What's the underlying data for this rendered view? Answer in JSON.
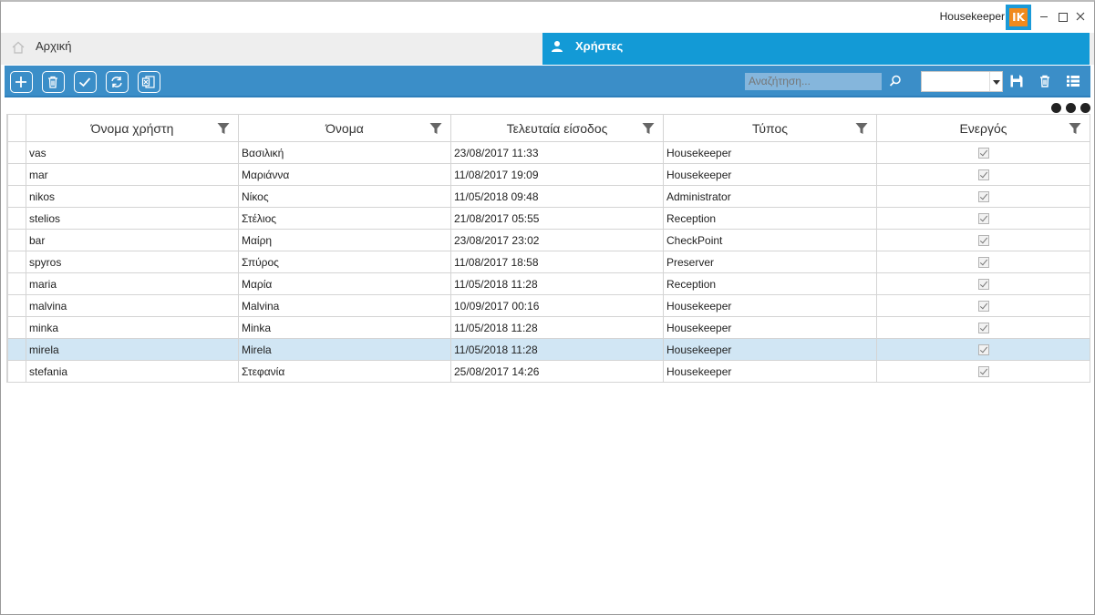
{
  "window": {
    "app_name": "Housekeeper",
    "logo_text": "IK"
  },
  "tabs": [
    {
      "label": "Αρχική",
      "icon": "home-icon"
    },
    {
      "label": "Χρήστες",
      "icon": "user-icon",
      "active": true
    }
  ],
  "toolbar": {
    "buttons": [
      "add-icon",
      "trash-icon",
      "check-icon",
      "refresh-icon",
      "excel-icon"
    ],
    "search_placeholder": "Αναζήτηση...",
    "layout_select_value": ""
  },
  "colors": {
    "tab_active": "#139ad6",
    "toolbar": "#3b8ec8",
    "selected_row": "#d1e6f4",
    "logo_blue": "#1a9ad8",
    "logo_orange": "#f08a1c"
  },
  "grid": {
    "columns": [
      "Όνομα χρήστη",
      "Όνομα",
      "Τελευταία είσοδος",
      "Τύπος",
      "Ενεργός"
    ],
    "rows": [
      {
        "username": "vas",
        "name": "Βασιλική",
        "last_login": "23/08/2017 11:33",
        "type": "Housekeeper",
        "active": true
      },
      {
        "username": "mar",
        "name": "Μαριάννα",
        "last_login": "11/08/2017 19:09",
        "type": "Housekeeper",
        "active": true
      },
      {
        "username": "nikos",
        "name": "Νίκος",
        "last_login": "11/05/2018 09:48",
        "type": "Administrator",
        "active": true
      },
      {
        "username": "stelios",
        "name": "Στέλιος",
        "last_login": "21/08/2017 05:55",
        "type": "Reception",
        "active": true
      },
      {
        "username": "bar",
        "name": "Μαίρη",
        "last_login": "23/08/2017 23:02",
        "type": "CheckPoint",
        "active": true
      },
      {
        "username": "spyros",
        "name": "Σπύρος",
        "last_login": "11/08/2017 18:58",
        "type": "Preserver",
        "active": true
      },
      {
        "username": "maria",
        "name": "Μαρία",
        "last_login": "11/05/2018 11:28",
        "type": "Reception",
        "active": true
      },
      {
        "username": "malvina",
        "name": "Malvina",
        "last_login": "10/09/2017 00:16",
        "type": "Housekeeper",
        "active": true
      },
      {
        "username": "minka",
        "name": "Minka",
        "last_login": "11/05/2018 11:28",
        "type": "Housekeeper",
        "active": true
      },
      {
        "username": "mirela",
        "name": "Mirela",
        "last_login": "11/05/2018 11:28",
        "type": "Housekeeper",
        "active": true,
        "selected": true
      },
      {
        "username": "stefania",
        "name": "Στεφανία",
        "last_login": "25/08/2017 14:26",
        "type": "Housekeeper",
        "active": true
      }
    ]
  }
}
